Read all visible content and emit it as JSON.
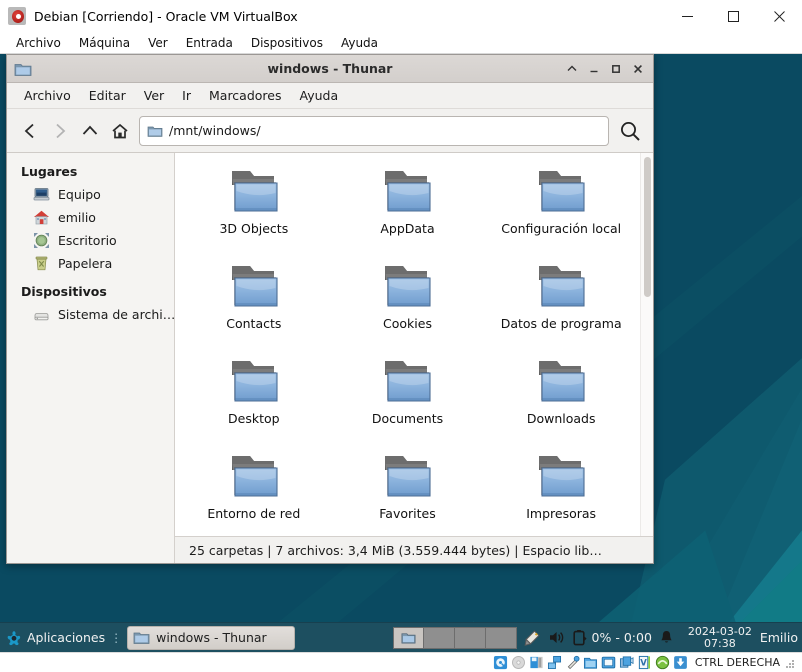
{
  "host": {
    "title": "Debian [Corriendo] - Oracle VM VirtualBox",
    "icon": "virtualbox-icon",
    "menus": [
      "Archivo",
      "Máquina",
      "Ver",
      "Entrada",
      "Dispositivos",
      "Ayuda"
    ],
    "window_buttons": [
      {
        "name": "minimize-button",
        "glyph": "minimize"
      },
      {
        "name": "maximize-button",
        "glyph": "maximize"
      },
      {
        "name": "close-button",
        "glyph": "close"
      }
    ],
    "statusbar": {
      "icons": [
        "hard-disk-icon",
        "optical-disk-icon",
        "floppy-disk-icon",
        "network-icon",
        "usb-icon",
        "shared-folders-icon",
        "display-icon",
        "video-capture-icon",
        "virtualbox-features-icon",
        "mouse-integration-icon",
        "host-key-icon"
      ],
      "host_key": "CTRL DERECHA",
      "grip": "resize-grip"
    }
  },
  "desktop": {
    "background_color": "#0a4a61",
    "accent_color": "#11687e"
  },
  "thunar": {
    "title": "windows - Thunar",
    "titlebar_icon": "folder-icon",
    "window_buttons": [
      {
        "name": "shade-button",
        "glyph": "shade"
      },
      {
        "name": "minimize-button",
        "glyph": "minimize"
      },
      {
        "name": "maximize-button",
        "glyph": "maximize"
      },
      {
        "name": "close-button",
        "glyph": "close"
      }
    ],
    "menus": [
      "Archivo",
      "Editar",
      "Ver",
      "Ir",
      "Marcadores",
      "Ayuda"
    ],
    "toolbar": {
      "back": "back-icon",
      "forward": "forward-icon",
      "up": "up-icon",
      "home": "home-icon",
      "search": "search-icon",
      "path_value": "/mnt/windows/",
      "path_placeholder": "",
      "path_icon": "folder-icon"
    },
    "sidebar": {
      "groups": [
        {
          "header": "Lugares",
          "items": [
            {
              "label": "Equipo",
              "icon": "computer-icon"
            },
            {
              "label": "emilio",
              "icon": "home-folder-icon"
            },
            {
              "label": "Escritorio",
              "icon": "desktop-icon"
            },
            {
              "label": "Papelera",
              "icon": "trash-icon"
            }
          ]
        },
        {
          "header": "Dispositivos",
          "items": [
            {
              "label": "Sistema de archi…",
              "icon": "filesystem-drive-icon"
            }
          ]
        }
      ]
    },
    "files": [
      {
        "name": "3D Objects",
        "type": "folder"
      },
      {
        "name": "AppData",
        "type": "folder"
      },
      {
        "name": "Configuración local",
        "type": "folder"
      },
      {
        "name": "Contacts",
        "type": "folder"
      },
      {
        "name": "Cookies",
        "type": "folder"
      },
      {
        "name": "Datos de programa",
        "type": "folder"
      },
      {
        "name": "Desktop",
        "type": "folder"
      },
      {
        "name": "Documents",
        "type": "folder"
      },
      {
        "name": "Downloads",
        "type": "folder"
      },
      {
        "name": "Entorno de red",
        "type": "folder"
      },
      {
        "name": "Favorites",
        "type": "folder"
      },
      {
        "name": "Impresoras",
        "type": "folder"
      }
    ],
    "statusbar": "25 carpetas  |  7 archivos: 3,4 MiB (3.559.444 bytes)  |  Espacio lib…"
  },
  "panel": {
    "apps_button": {
      "label": "Aplicaciones",
      "icon": "xfce-mouse-icon"
    },
    "separator": "⋮",
    "task_button": {
      "label": "windows - Thunar",
      "icon": "folder-icon"
    },
    "workspaces": [
      {
        "name": "workspace-1",
        "active": true,
        "icon": "folder-icon"
      },
      {
        "name": "workspace-2",
        "active": false,
        "icon": ""
      },
      {
        "name": "workspace-3",
        "active": false,
        "icon": ""
      },
      {
        "name": "workspace-4",
        "active": false,
        "icon": ""
      }
    ],
    "tray": [
      {
        "name": "stylus-icon",
        "label": ""
      },
      {
        "name": "volume-icon",
        "label": ""
      },
      {
        "name": "battery-icon",
        "label": "0% - 0:00"
      },
      {
        "name": "notification-bell-icon",
        "label": ""
      }
    ],
    "clock": {
      "date": "2024-03-02",
      "time": "07:38"
    },
    "user": "Emilio"
  }
}
